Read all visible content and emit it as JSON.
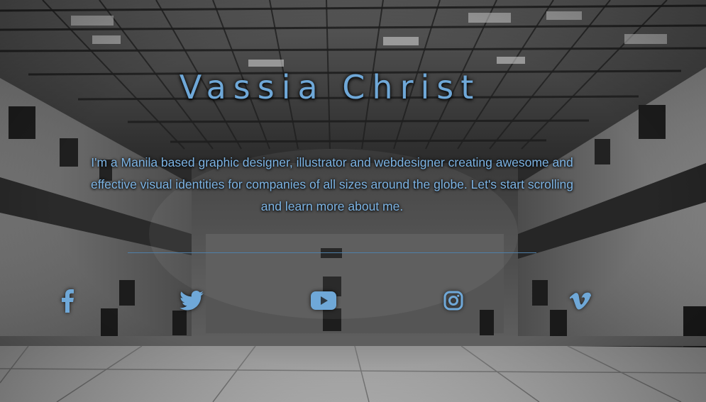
{
  "hero": {
    "title": "Vassia Christ",
    "intro": "I'm a Manila based graphic designer, illustrator and webdesigner creating awesome and effective visual identities for companies of all sizes around the globe. Let's start scrolling and learn more about me."
  },
  "social": [
    {
      "icon": "facebook-icon"
    },
    {
      "icon": "twitter-icon"
    },
    {
      "icon": "youtube-icon"
    },
    {
      "icon": "instagram-icon"
    },
    {
      "icon": "vimeo-icon"
    }
  ],
  "colors": {
    "accent": "#6fa8d8",
    "text": "#7cb3e3",
    "divider": "#4f7fa8"
  }
}
